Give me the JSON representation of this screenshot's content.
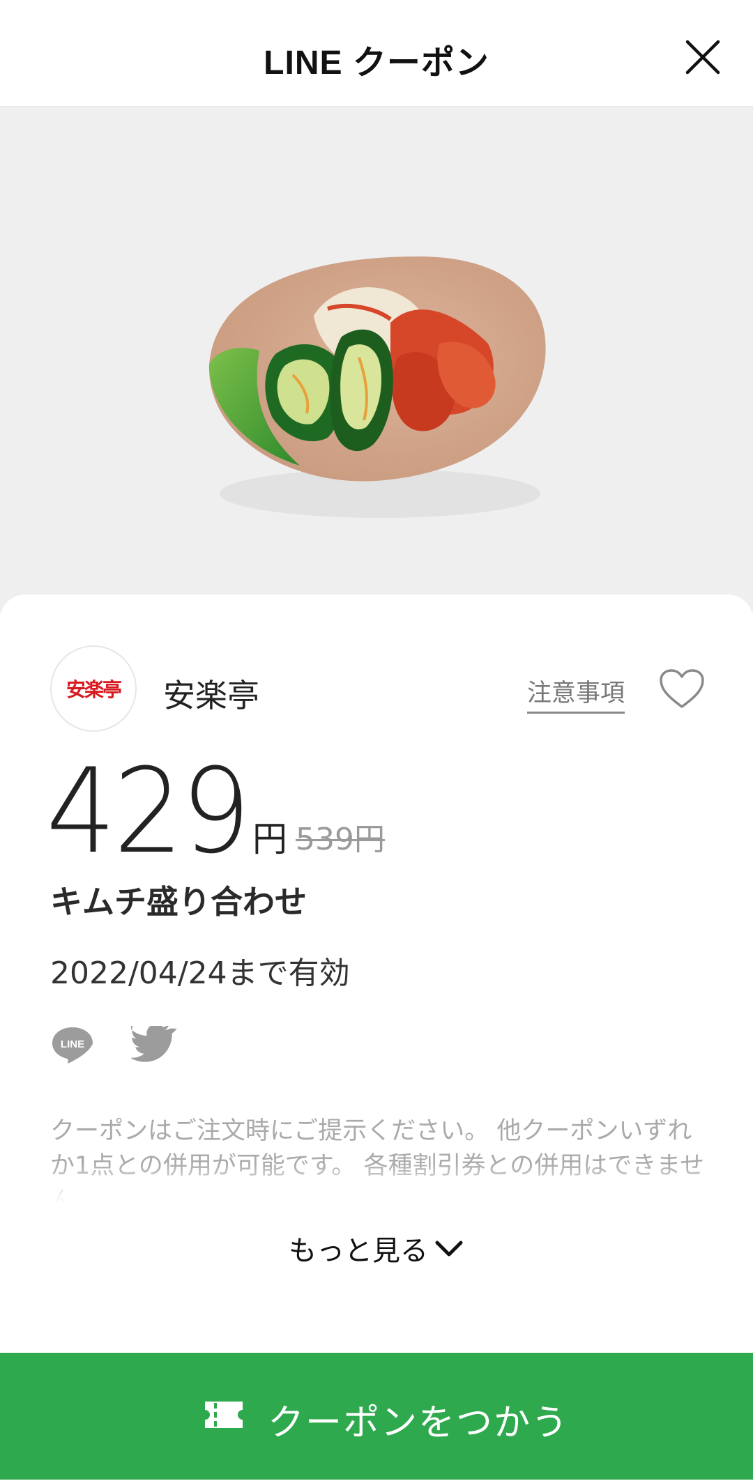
{
  "header": {
    "title": "LINE クーポン",
    "close_icon": "close-icon"
  },
  "hero": {
    "image": "kimchi-plate"
  },
  "shop": {
    "logo_text": "安楽亭",
    "name": "安楽亭",
    "notice_label": "注意事項",
    "favorite_icon": "heart-outline-icon"
  },
  "price": {
    "value": "429",
    "currency": "円",
    "original": "539円"
  },
  "product": {
    "name": "キムチ盛り合わせ"
  },
  "validity": "2022/04/24まで有効",
  "share": {
    "line_icon": "line-icon",
    "twitter_icon": "twitter-icon"
  },
  "description": "クーポンはご注文時にご提示ください。 他クーポンいずれか1点との併用が可能です。 各種割引券との併用はできません。",
  "more": {
    "label": "もっと見る",
    "icon": "chevron-down-icon"
  },
  "use_button": {
    "label": "クーポンをつかう",
    "icon": "ticket-icon"
  },
  "colors": {
    "accent_green": "#2ea94e",
    "logo_red": "#d71920"
  }
}
